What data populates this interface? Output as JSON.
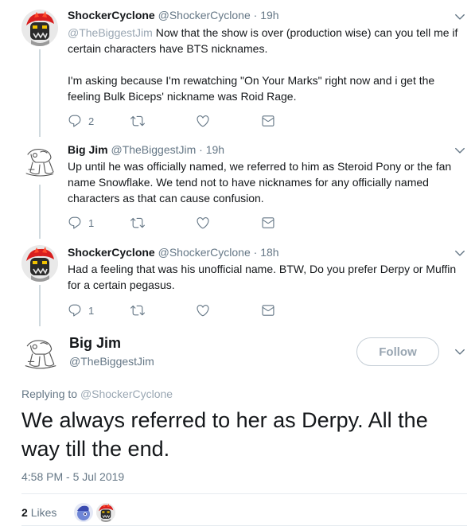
{
  "tweets": [
    {
      "name": "ShockerCyclone",
      "handle": "@ShockerCyclone",
      "time": "19h",
      "mention": "@TheBiggestJim",
      "text1": " Now that the show is over (production wise) can you tell me if certain characters have BTS nicknames.",
      "text2": "I'm asking because I'm rewatching \"On Your Marks\" right now and i get the feeling Bulk Biceps' nickname was Roid Rage.",
      "replies": "2",
      "avatar": "red-dragon-avatar"
    },
    {
      "name": "Big Jim",
      "handle": "@TheBiggestJim",
      "time": "19h",
      "text1": "Up until he was officially named, we referred to him as Steroid Pony or the fan name Snowflake. We tend not to have nicknames for any officially named characters as that can cause confusion.",
      "replies": "1",
      "avatar": "sketch-pony-avatar"
    },
    {
      "name": "ShockerCyclone",
      "handle": "@ShockerCyclone",
      "time": "18h",
      "text1": "Had a feeling that was his unofficial name. BTW, Do you prefer Derpy or Muffin for a certain pegasus.",
      "replies": "1",
      "avatar": "red-dragon-avatar"
    }
  ],
  "main": {
    "name": "Big Jim",
    "handle": "@TheBiggestJim",
    "follow_label": "Follow",
    "replying_prefix": "Replying to ",
    "replying_to": "@ShockerCyclone",
    "text": "We always referred to her as Derpy. All the way till the end.",
    "timestamp": "4:58 PM - 5 Jul 2019",
    "likes_count": "2",
    "likes_label": "Likes"
  },
  "colors": {
    "text": "#14171a",
    "secondary": "#657786",
    "divider": "#e6ecf0"
  }
}
